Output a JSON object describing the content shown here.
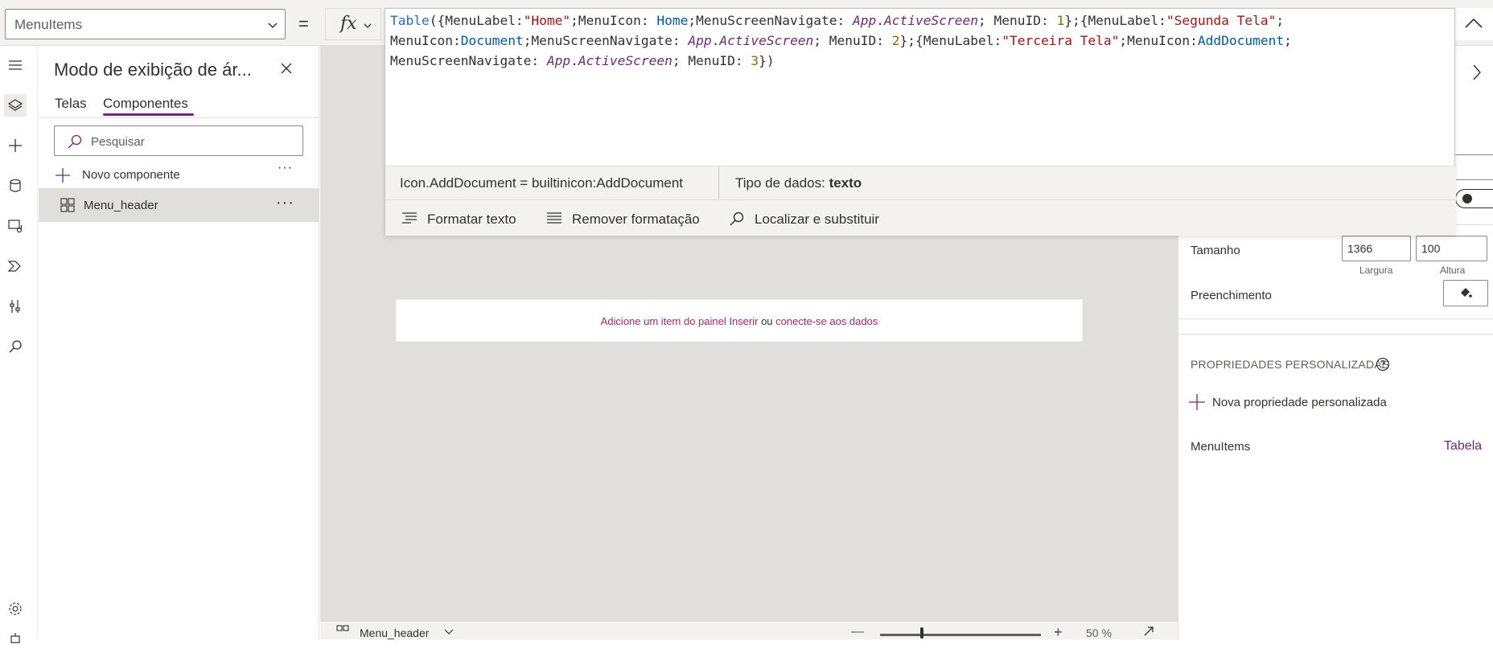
{
  "formula_bar": {
    "property": "MenuItems",
    "equals": "=",
    "fx": "fx"
  },
  "formula_editor": {
    "code_lines": [
      [
        {
          "t": "Table",
          "c": "fn"
        },
        {
          "t": "({MenuLabel:"
        },
        {
          "t": "\"Home\"",
          "c": "str"
        },
        {
          "t": ";MenuIcon: "
        },
        {
          "t": "Home",
          "c": "id"
        },
        {
          "t": ";MenuScreenNavigate: "
        },
        {
          "t": "App",
          "c": "app"
        },
        {
          "t": "."
        },
        {
          "t": "ActiveScreen",
          "c": "app"
        },
        {
          "t": "; MenuID: "
        },
        {
          "t": "1",
          "c": "num"
        },
        {
          "t": "};{MenuLabel:"
        },
        {
          "t": "\"Segunda Tela\"",
          "c": "str"
        },
        {
          "t": ";"
        }
      ],
      [
        {
          "t": "MenuIcon:"
        },
        {
          "t": "Document",
          "c": "id"
        },
        {
          "t": ";MenuScreenNavigate: "
        },
        {
          "t": "App",
          "c": "app"
        },
        {
          "t": "."
        },
        {
          "t": "ActiveScreen",
          "c": "app"
        },
        {
          "t": "; MenuID: "
        },
        {
          "t": "2",
          "c": "num"
        },
        {
          "t": "};{MenuLabel:"
        },
        {
          "t": "\"Terceira Tela\"",
          "c": "str"
        },
        {
          "t": ";MenuIcon:"
        },
        {
          "t": "AddDocument",
          "c": "id"
        },
        {
          "t": ";"
        }
      ],
      [
        {
          "t": "MenuScreenNavigate: "
        },
        {
          "t": "App",
          "c": "app"
        },
        {
          "t": "."
        },
        {
          "t": "ActiveScreen",
          "c": "app"
        },
        {
          "t": "; MenuID: "
        },
        {
          "t": "3",
          "c": "num"
        },
        {
          "t": "})"
        }
      ]
    ],
    "signature": "Icon.AddDocument  =  builtinicon:AddDocument",
    "data_type_label": "Tipo de dados: ",
    "data_type_value": "texto",
    "tools": {
      "format": "Formatar texto",
      "remove": "Remover formatação",
      "find": "Localizar e substituir"
    }
  },
  "tree_panel": {
    "title": "Modo de exibição de ár...",
    "tabs": [
      "Telas",
      "Componentes"
    ],
    "search_placeholder": "Pesquisar",
    "new_component": "Novo componente",
    "new_component_more": "···",
    "items": [
      {
        "label": "Menu_header",
        "more": "···"
      }
    ]
  },
  "canvas": {
    "placeholder_part1": "Adicione um item do painel Inserir",
    "placeholder_part2": " ou ",
    "placeholder_part3": "conecte-se aos dados",
    "footer_component": "Menu_header",
    "zoom_minus": "—",
    "zoom_plus": "+",
    "zoom_percent": "50  %",
    "zoom_level": 0.5
  },
  "properties": {
    "tamanho_label": "Tamanho",
    "largura_value": "1366",
    "altura_value": "100",
    "largura_label": "Largura",
    "altura_label": "Altura",
    "preenchimento_label": "Preenchimento",
    "custom_props_title": "PROPRIEDADES PERSONALIZADAS",
    "new_custom_prop": "Nova propriedade personalizada",
    "menuitems_label": "MenuItems",
    "menuitems_value": "Tabela"
  },
  "colors": {
    "accent": "#742774",
    "link": "#a8286e",
    "canvas_bg": "#e1dfdd"
  }
}
